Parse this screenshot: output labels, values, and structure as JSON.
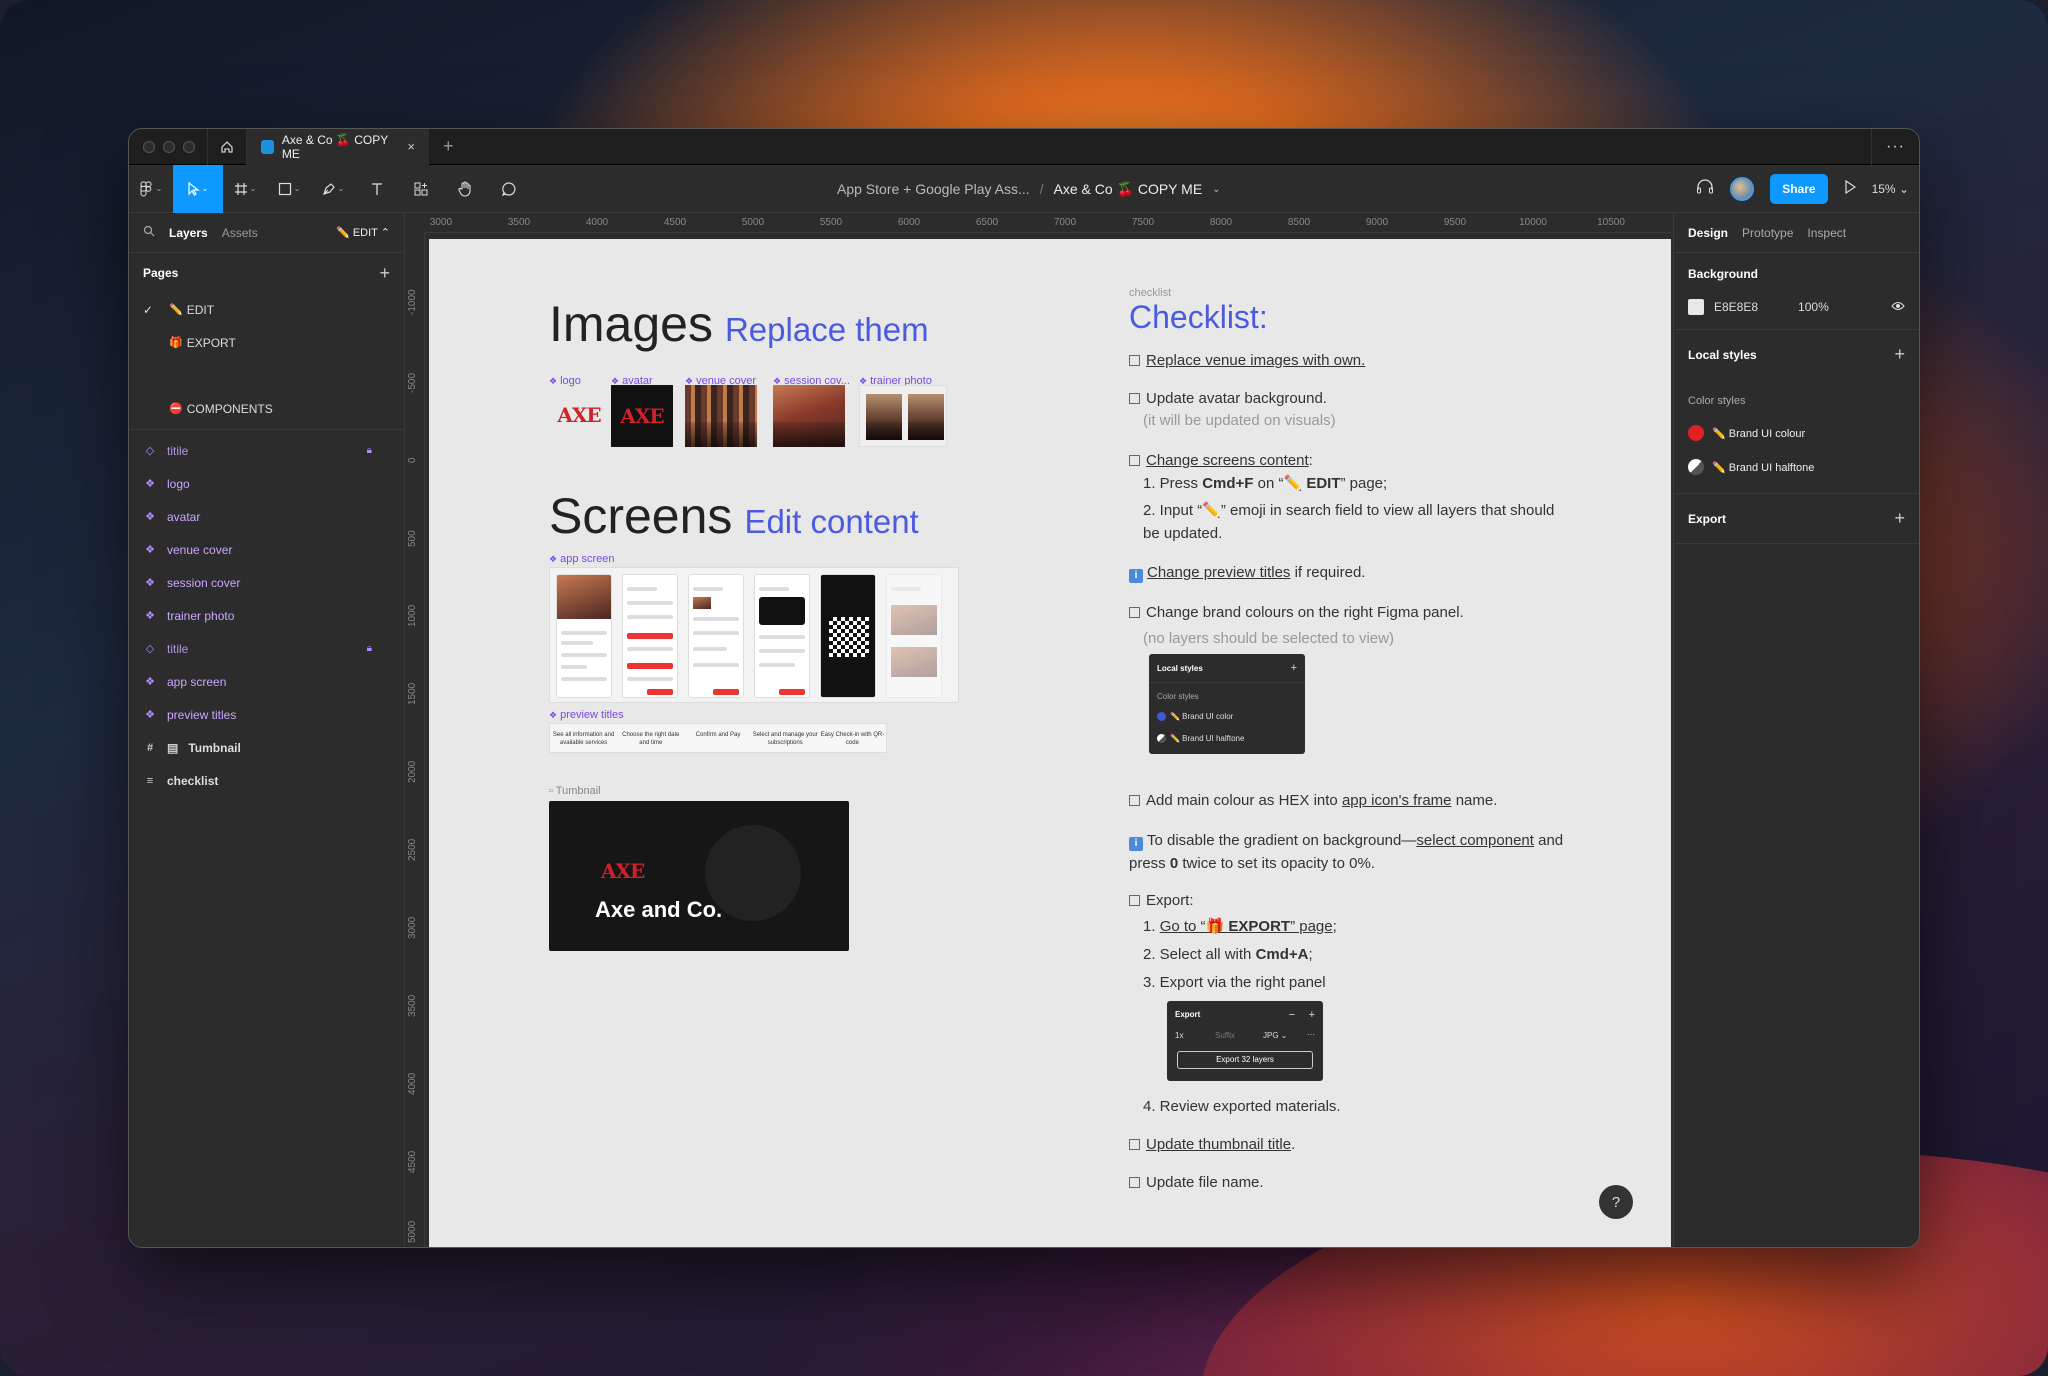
{
  "colors": {
    "accent": "#0d99ff",
    "brand_red": "#e32024",
    "brand_ui": "#e32024",
    "canvas_bg": "#E8E8E8",
    "heading_accent": "#4b5bdf"
  },
  "titlebar": {
    "tab_title": "Axe & Co 🍒 COPY ME",
    "close": "×",
    "new_tab": "+",
    "more": "···"
  },
  "toolbar": {
    "breadcrumb_project": "App Store + Google Play Ass...",
    "breadcrumb_sep": "/",
    "breadcrumb_file": "Axe & Co 🍒 COPY ME",
    "share": "Share",
    "zoom": "15%"
  },
  "left_panel": {
    "tabs": {
      "layers": "Layers",
      "assets": "Assets",
      "page_selector": "✏️ EDIT"
    },
    "pages_title": "Pages",
    "pages": [
      {
        "icon": "✏️",
        "label": "EDIT",
        "selected": true
      },
      {
        "icon": "🎁",
        "label": "EXPORT"
      },
      {
        "icon": "⛔",
        "label": "COMPONENTS"
      }
    ],
    "layers": [
      {
        "label": "titile",
        "type": "instance-outline",
        "locked": true
      },
      {
        "label": "logo",
        "type": "component"
      },
      {
        "label": "avatar",
        "type": "component"
      },
      {
        "label": "venue cover",
        "type": "component"
      },
      {
        "label": "session cover",
        "type": "component"
      },
      {
        "label": "trainer photo",
        "type": "component"
      },
      {
        "label": "titile",
        "type": "instance-outline",
        "locked": true
      },
      {
        "label": "app screen",
        "type": "component"
      },
      {
        "label": "preview titles",
        "type": "component"
      },
      {
        "label": "Tumbnail",
        "type": "frame"
      },
      {
        "label": "checklist",
        "type": "text"
      }
    ]
  },
  "rulers": {
    "top": [
      "3000",
      "3500",
      "4000",
      "4500",
      "5000",
      "5500",
      "6000",
      "6500",
      "7000",
      "7500",
      "8000",
      "8500",
      "9000",
      "9500",
      "10000",
      "10500"
    ],
    "left": [
      "-1000",
      "-500",
      "0",
      "500",
      "1000",
      "1500",
      "2000",
      "2500",
      "3000",
      "3500",
      "4000",
      "4500",
      "5000"
    ]
  },
  "canvas": {
    "images_title": "Images",
    "images_accent": "Replace them",
    "image_labels": {
      "logo": "logo",
      "avatar": "avatar",
      "venue": "venue cover",
      "session": "session cov...",
      "trainer": "trainer photo"
    },
    "logo_text": "AXE",
    "screens_title": "Screens",
    "screens_accent": "Edit content",
    "app_screen_label": "app screen",
    "preview_titles_label": "preview titles",
    "preview_titles": [
      "See all information and available services",
      "Choose the right date and time",
      "Confirm and Pay",
      "Select and manage your subscriptions",
      "Easy Check-in with QR-code"
    ],
    "thumbnail_label": "Tumbnail",
    "thumbnail_logo": "AXE",
    "thumbnail_name": "Axe and Co."
  },
  "checklist": {
    "tag": "checklist",
    "title": "Checklist:",
    "items": {
      "i1": "Replace venue images with own.",
      "i2": "Update avatar background.",
      "i2_note": "(it will be updated on visuals)",
      "i3": "Change screens content",
      "i3_colon": ":",
      "i3_s1_a": "1. Press ",
      "i3_s1_b": "Cmd+F",
      "i3_s1_c": " on “✏️ ",
      "i3_s1_d": "EDIT",
      "i3_s1_e": "” page;",
      "i3_s2": "2. Input “✏️” emoji in search field to view all layers that should be updated.",
      "i4_info": "i",
      "i4_a": "Change preview titles",
      "i4_b": " if required.",
      "i5": "Change brand colours on the right Figma panel.",
      "i5_note": "(no layers should be selected to view)",
      "i6_a": "Add main colour as HEX into ",
      "i6_b": "app icon's frame",
      "i6_c": " name.",
      "i7_info": "i",
      "i7_a": "To disable the gradient on background—",
      "i7_b": "select component",
      "i7_c": " and press ",
      "i7_d": "0",
      "i7_e": " twice to set its opacity to 0%.",
      "i8": "Export:",
      "i8_s1_a": "1. ",
      "i8_s1_b": "Go to “🎁 ",
      "i8_s1_c": "EXPORT",
      "i8_s1_d": "” page",
      "i8_s1_e": ";",
      "i8_s2_a": "2. Select all with ",
      "i8_s2_b": "Cmd+A",
      "i8_s2_c": ";",
      "i8_s3": "3. Export via the right panel",
      "i8_s4": "4. Review exported materials.",
      "i9": "Update thumbnail title",
      "i9_dot": ".",
      "i10": "Update file name."
    },
    "mini_styles": {
      "title": "Local styles",
      "plus": "+",
      "sub": "Color styles",
      "c1": "✏️ Brand UI color",
      "c2": "✏️ Brand UI halftone"
    },
    "mini_export": {
      "title": "Export",
      "minus": "−",
      "plus": "+",
      "scale": "1x",
      "suffix": "Suffix",
      "format": "JPG ⌄",
      "dots": "···",
      "button": "Export 32 layers"
    }
  },
  "right_panel": {
    "tabs": {
      "design": "Design",
      "prototype": "Prototype",
      "inspect": "Inspect"
    },
    "background_title": "Background",
    "background_hex": "E8E8E8",
    "background_opacity": "100%",
    "local_styles_title": "Local styles",
    "color_styles_label": "Color styles",
    "color_styles": [
      {
        "label": "✏️ Brand UI colour",
        "color": "#e32024"
      },
      {
        "label": "✏️ Brand UI halftone",
        "color": "halftone"
      }
    ],
    "export_title": "Export",
    "plus": "+"
  },
  "help": "?"
}
